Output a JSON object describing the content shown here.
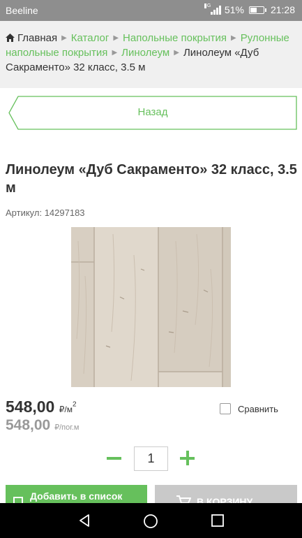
{
  "status": {
    "carrier": "Beeline",
    "network": "4G",
    "battery": "51%",
    "battery_level": 0.51,
    "time": "21:28"
  },
  "breadcrumbs": {
    "home": "Главная",
    "items": [
      "Каталог",
      "Напольные покрытия",
      "Рулонные напольные покрытия",
      "Линолеум"
    ],
    "current": "Линолеум «Дуб Сакраменто» 32 класс, 3.5 м"
  },
  "back_label": "Назад",
  "product": {
    "title": "Линолеум «Дуб Сакраменто» 32 класс, 3.5 м",
    "sku": "Артикул: 14297183",
    "price_main": "548,00",
    "price_main_unit": "₽/м",
    "price_main_sup": "2",
    "price_alt": "548,00",
    "price_alt_unit": "₽/пог.м"
  },
  "compare_label": "Сравнить",
  "quantity": "1",
  "buttons": {
    "add_to_list": "Добавить в список",
    "to_cart": "В КОРЗИНУ"
  },
  "colors": {
    "accent": "#66c05c",
    "statusbar": "#8e8e8e",
    "crumbs_bg": "#f0f0f0",
    "cart_disabled": "#c9c9c9"
  }
}
